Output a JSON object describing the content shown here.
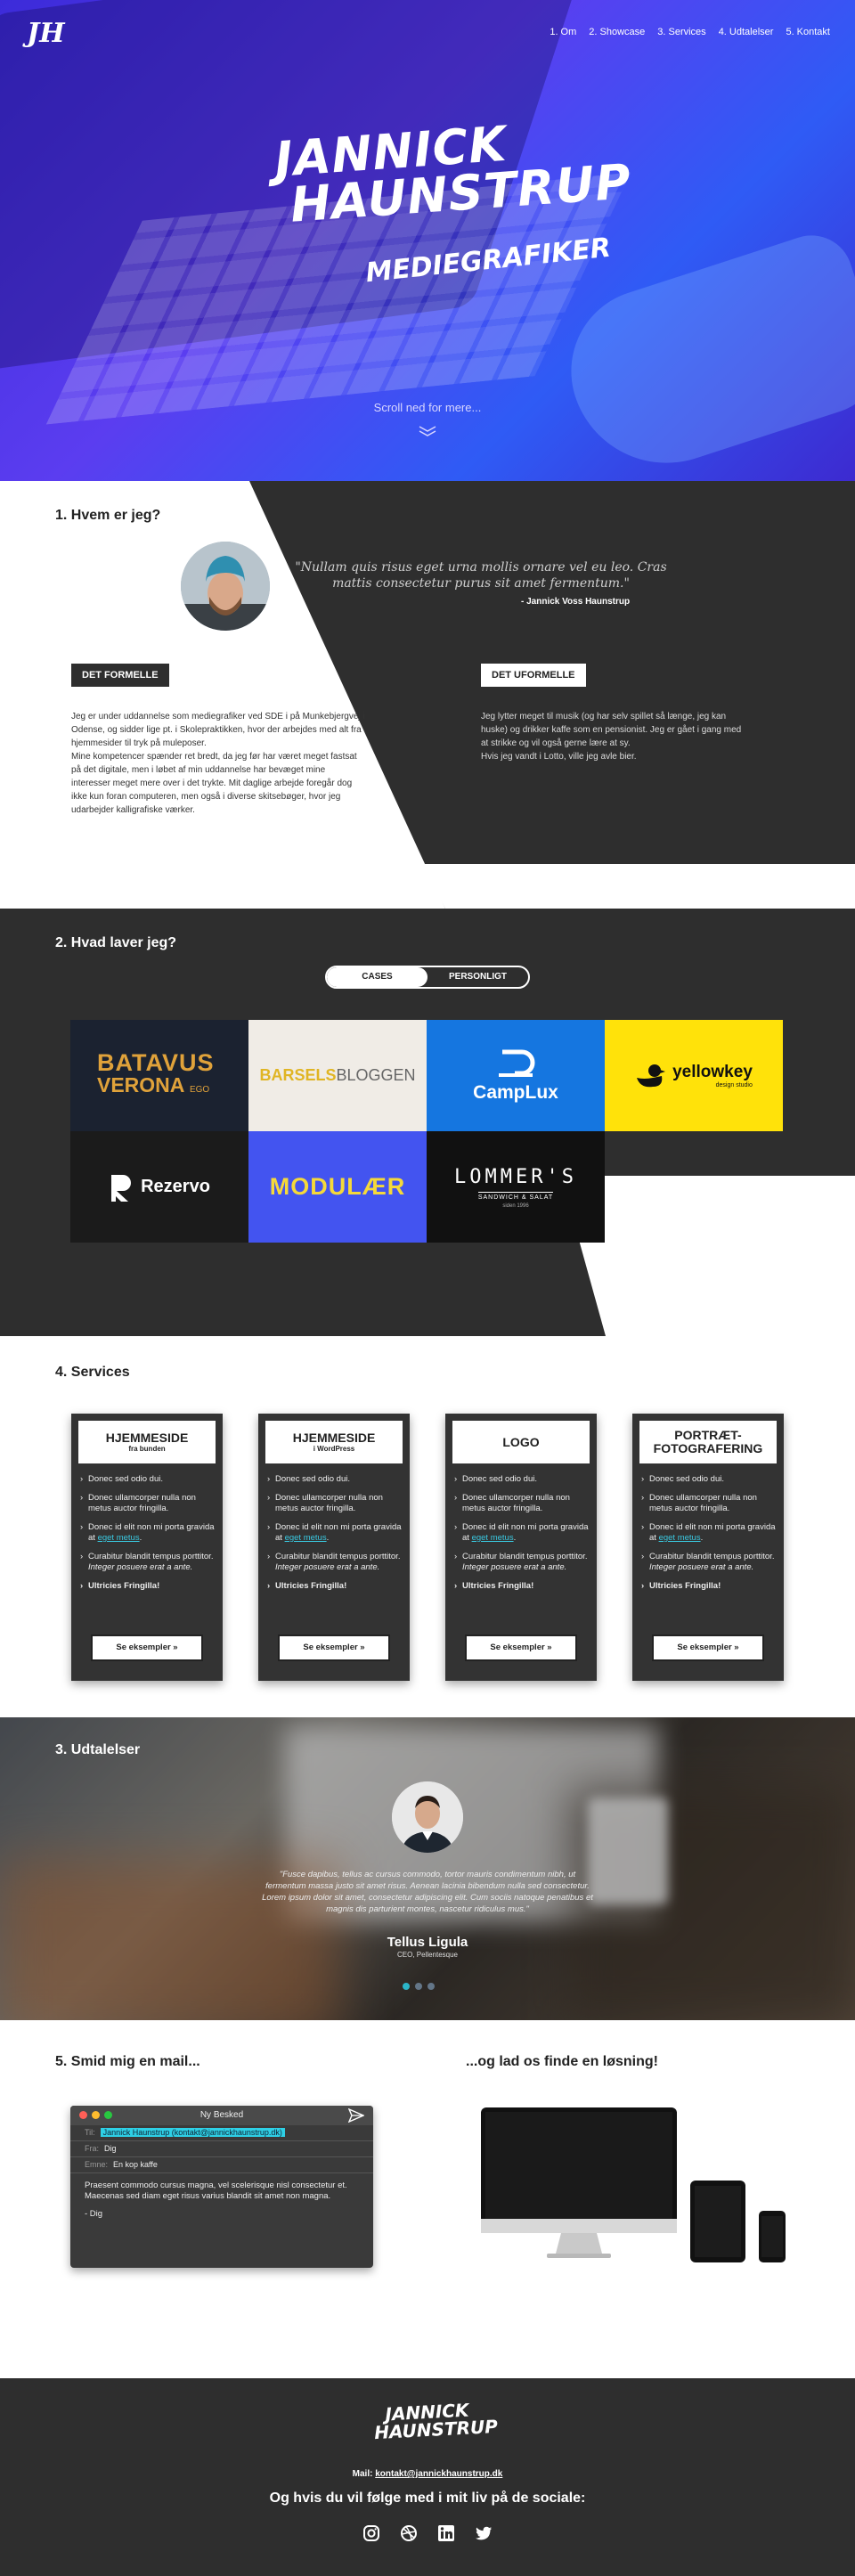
{
  "hero": {
    "logo": "JH",
    "nav": [
      "1. Om",
      "2. Showcase",
      "3. Services",
      "4. Udtalelser",
      "5. Kontakt"
    ],
    "name_line1": "JANNICK",
    "name_line2": "HAUNSTRUP",
    "role": "MEDIEGRAFIKER",
    "scroll_text": "Scroll ned for mere...",
    "colors": {
      "primary": "#4b35e8",
      "secondary": "#2f5bf5"
    }
  },
  "about": {
    "heading": "1. Hvem er jeg?",
    "quote": "\"Nullam quis risus eget urna mollis ornare vel eu leo. Cras mattis consectetur purus sit amet fermentum.\"",
    "quote_author": "- Jannick Voss Haunstrup",
    "formal_tag": "DET FORMELLE",
    "informal_tag": "DET UFORMELLE",
    "formal_text": [
      "Jeg er under uddannelse som mediegrafiker ved SDE i på Munkebjergvej i Odense, og sidder lige pt. i Skolepraktikken, hvor der arbejdes med alt fra hjemmesider til tryk på muleposer.",
      "Mine kompetencer spænder ret bredt, da jeg før har været meget fastsat på det digitale, men i løbet af min uddannelse har bevæget mine interesser meget mere over i det trykte. Mit daglige arbejde foregår dog ikke kun foran computeren, men også i diverse skitsebøger, hvor jeg udarbejder kalligrafiske værker."
    ],
    "informal_text": [
      "Jeg lytter meget til musik (og har selv spillet så længe, jeg kan huske) og drikker kaffe som en pensionist. Jeg er gået i gang med at strikke og vil også gerne lære at sy.",
      "Hvis jeg vandt i Lotto, ville jeg avle bier."
    ]
  },
  "showcase": {
    "heading": "2. Hvad laver jeg?",
    "toggle": [
      "CASES",
      "PERSONLIGT"
    ],
    "tiles": [
      {
        "name": "batavus-verona",
        "line1": "BATAVUS",
        "line2": "VERONA",
        "suffix": "EGO",
        "bg": "#1b2230",
        "fg": "#e0a23a"
      },
      {
        "name": "barselsbloggen",
        "line1": "BARSELS",
        "line2": "BLOGGEN",
        "bg": "#f0ece6",
        "fg": "#e0b524"
      },
      {
        "name": "camplux",
        "line1": "CampLux",
        "bg": "#1576e0",
        "fg": "#ffffff"
      },
      {
        "name": "yellowkey",
        "line1": "yellowkey",
        "line2": "design studio",
        "bg": "#ffe20a",
        "fg": "#111111"
      },
      {
        "name": "rezervo",
        "line1": "Rezervo",
        "bg": "#1b1b1b",
        "fg": "#ffffff"
      },
      {
        "name": "modulaer",
        "line1": "MODULÆR",
        "bg": "#4354f0",
        "fg": "#f5d93a"
      },
      {
        "name": "lommers",
        "line1": "LOMMER'S",
        "line2": "SANDWICH & SALAT",
        "line3": "siden 1996",
        "bg": "#111111",
        "fg": "#ffffff"
      }
    ]
  },
  "services": {
    "heading": "4. Services",
    "cards": [
      {
        "title": "HJEMMESIDE",
        "sub": "fra bunden"
      },
      {
        "title": "HJEMMESIDE",
        "sub": "i WordPress"
      },
      {
        "title": "LOGO",
        "sub": ""
      },
      {
        "title": "PORTRÆT-",
        "title2": "FOTOGRAFERING",
        "sub": ""
      }
    ],
    "items": {
      "i1": "Donec sed odio dui.",
      "i2": "Donec ullamcorper nulla non metus auctor fringilla.",
      "i3a": "Donec id elit non mi porta gravida at",
      "i3b": "eget metus",
      "i4a": "Curabitur blandit tempus porttitor.",
      "i4b": "Integer posuere erat a ante.",
      "i5": "Ultricies Fringilla!"
    },
    "button": "Se eksempler »"
  },
  "testimonials": {
    "heading": "3. Udtalelser",
    "quote": "\"Fusce dapibus, tellus ac cursus commodo, tortor mauris condimentum nibh, ut fermentum massa justo sit amet risus. Aenean lacinia bibendum nulla sed consectetur. Lorem ipsum dolor sit amet, consectetur adipiscing elit. Cum sociis natoque penatibus et magnis dis parturient montes, nascetur ridiculus mus.\"",
    "name": "Tellus Ligula",
    "position": "CEO, Pellentesque",
    "slide": 1,
    "slides": 3
  },
  "contact": {
    "heading_left": "5. Smid mig en mail...",
    "heading_right": "...og lad os finde en løsning!",
    "window_title": "Ny Besked",
    "to_label": "Til:",
    "to_value": "Jannick Haunstrup (kontakt@jannickhaunstrup.dk)",
    "from_label": "Fra:",
    "from_value": "Dig",
    "subject_label": "Emne:",
    "subject_value": "En kop kaffe",
    "body": "Praesent commodo cursus magna, vel scelerisque nisl consectetur et. Maecenas sed diam eget risus varius blandit sit amet non magna.",
    "sign": "- Dig"
  },
  "footer": {
    "logo_line1": "JANNICK",
    "logo_line2": "HAUNSTRUP",
    "mail_label": "Mail:",
    "mail": "kontakt@jannickhaunstrup.dk",
    "social_title": "Og hvis du vil følge med i mit liv på de sociale:",
    "icons": [
      "instagram-icon",
      "dribbble-icon",
      "linkedin-icon",
      "twitter-icon"
    ]
  }
}
